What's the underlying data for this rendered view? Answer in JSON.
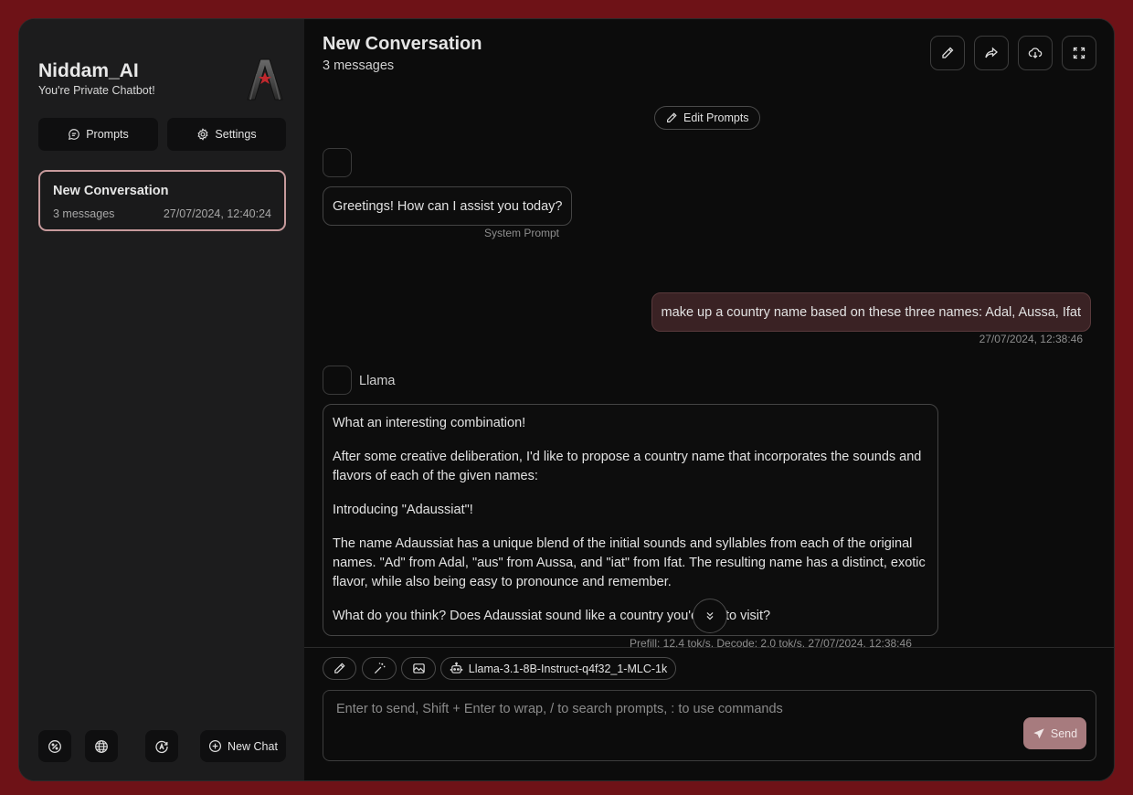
{
  "sidebar": {
    "brand_title": "Niddam_AI",
    "brand_subtitle": "You're Private Chatbot!",
    "prompts_label": "Prompts",
    "settings_label": "Settings",
    "conversations": [
      {
        "title": "New Conversation",
        "meta": "3 messages",
        "date": "27/07/2024, 12:40:24"
      }
    ],
    "new_chat_label": "New Chat"
  },
  "header": {
    "title": "New Conversation",
    "count": "3 messages"
  },
  "chat": {
    "edit_prompts_label": "Edit Prompts",
    "system_message": "Greetings! How can I assist you today?",
    "system_label": "System Prompt",
    "user_message": "make up a country name based on these three names: Adal, Aussa, Ifat",
    "user_date": "27/07/2024, 12:38:46",
    "bot_name": "Llama",
    "bot_paragraphs": [
      "What an interesting combination!",
      "After some creative deliberation, I'd like to propose a country name that incorporates the sounds and flavors of each of the given names:",
      "Introducing \"Adaussiat\"!",
      "The name Adaussiat has a unique blend of the initial sounds and syllables from each of the original names. \"Ad\" from Adal, \"aus\" from Aussa, and \"iat\" from Ifat. The resulting name has a distinct, exotic flavor, while also being easy to pronounce and remember.",
      "What do you think? Does Adaussiat sound like a country you'd like to visit?"
    ],
    "bot_meta": "Prefill: 12.4 tok/s,  Decode: 2.0 tok/s,  27/07/2024, 12:38:46"
  },
  "composer": {
    "model_name": "Llama-3.1-8B-Instruct-q4f32_1-MLC-1k",
    "placeholder": "Enter to send, Shift + Enter to wrap, / to search prompts, : to use commands",
    "send_label": "Send"
  },
  "colors": {
    "background": "#6e1217",
    "accent": "#a77b7e",
    "user_bubble": "#3a2224",
    "active_border": "#c79a9c"
  }
}
